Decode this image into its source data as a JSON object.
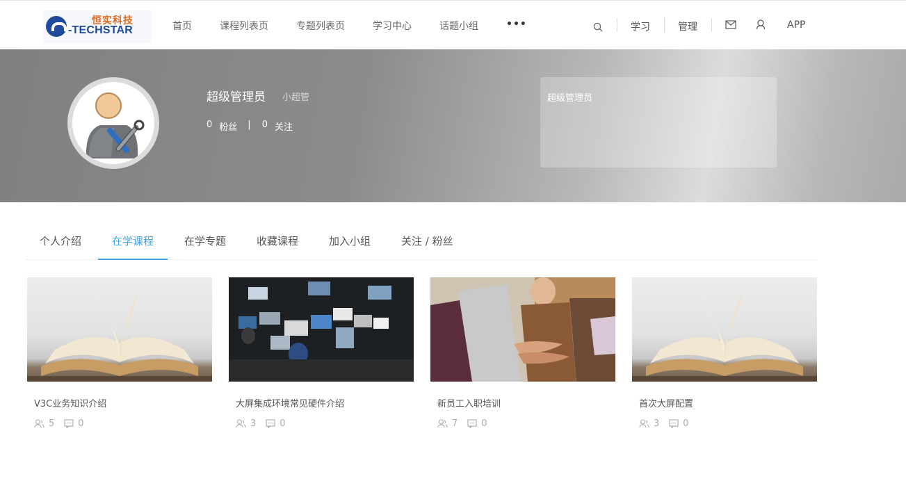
{
  "header": {
    "logo_cn": "恒实科技",
    "logo_en": "-TECHSTAR",
    "nav": [
      "首页",
      "课程列表页",
      "专题列表页",
      "学习中心",
      "话题小组",
      "•••"
    ],
    "right": {
      "study": "学习",
      "admin": "管理",
      "app": "APP"
    }
  },
  "profile": {
    "name": "超级管理员",
    "nickname": "小超管",
    "fans_count": "0",
    "fans_label": "粉丝",
    "follow_count": "0",
    "follow_label": "关注",
    "separator": "|",
    "intro": "超级管理员"
  },
  "tabs": [
    "个人介绍",
    "在学课程",
    "在学专题",
    "收藏课程",
    "加入小组",
    "关注 / 粉丝"
  ],
  "active_tab": "在学课程",
  "courses": [
    {
      "title": "V3C业务知识介绍",
      "students": "5",
      "comments": "0",
      "image": "open-book"
    },
    {
      "title": "大屏集成环境常见硬件介绍",
      "students": "3",
      "comments": "0",
      "image": "control-room"
    },
    {
      "title": "新员工入职培训",
      "students": "7",
      "comments": "0",
      "image": "team-hands"
    },
    {
      "title": "首次大屏配置",
      "students": "3",
      "comments": "0",
      "image": "open-book"
    }
  ],
  "colors": {
    "accent": "#3fa5e3",
    "logo_blue": "#1e4b9c",
    "logo_orange": "#e36a1f"
  }
}
